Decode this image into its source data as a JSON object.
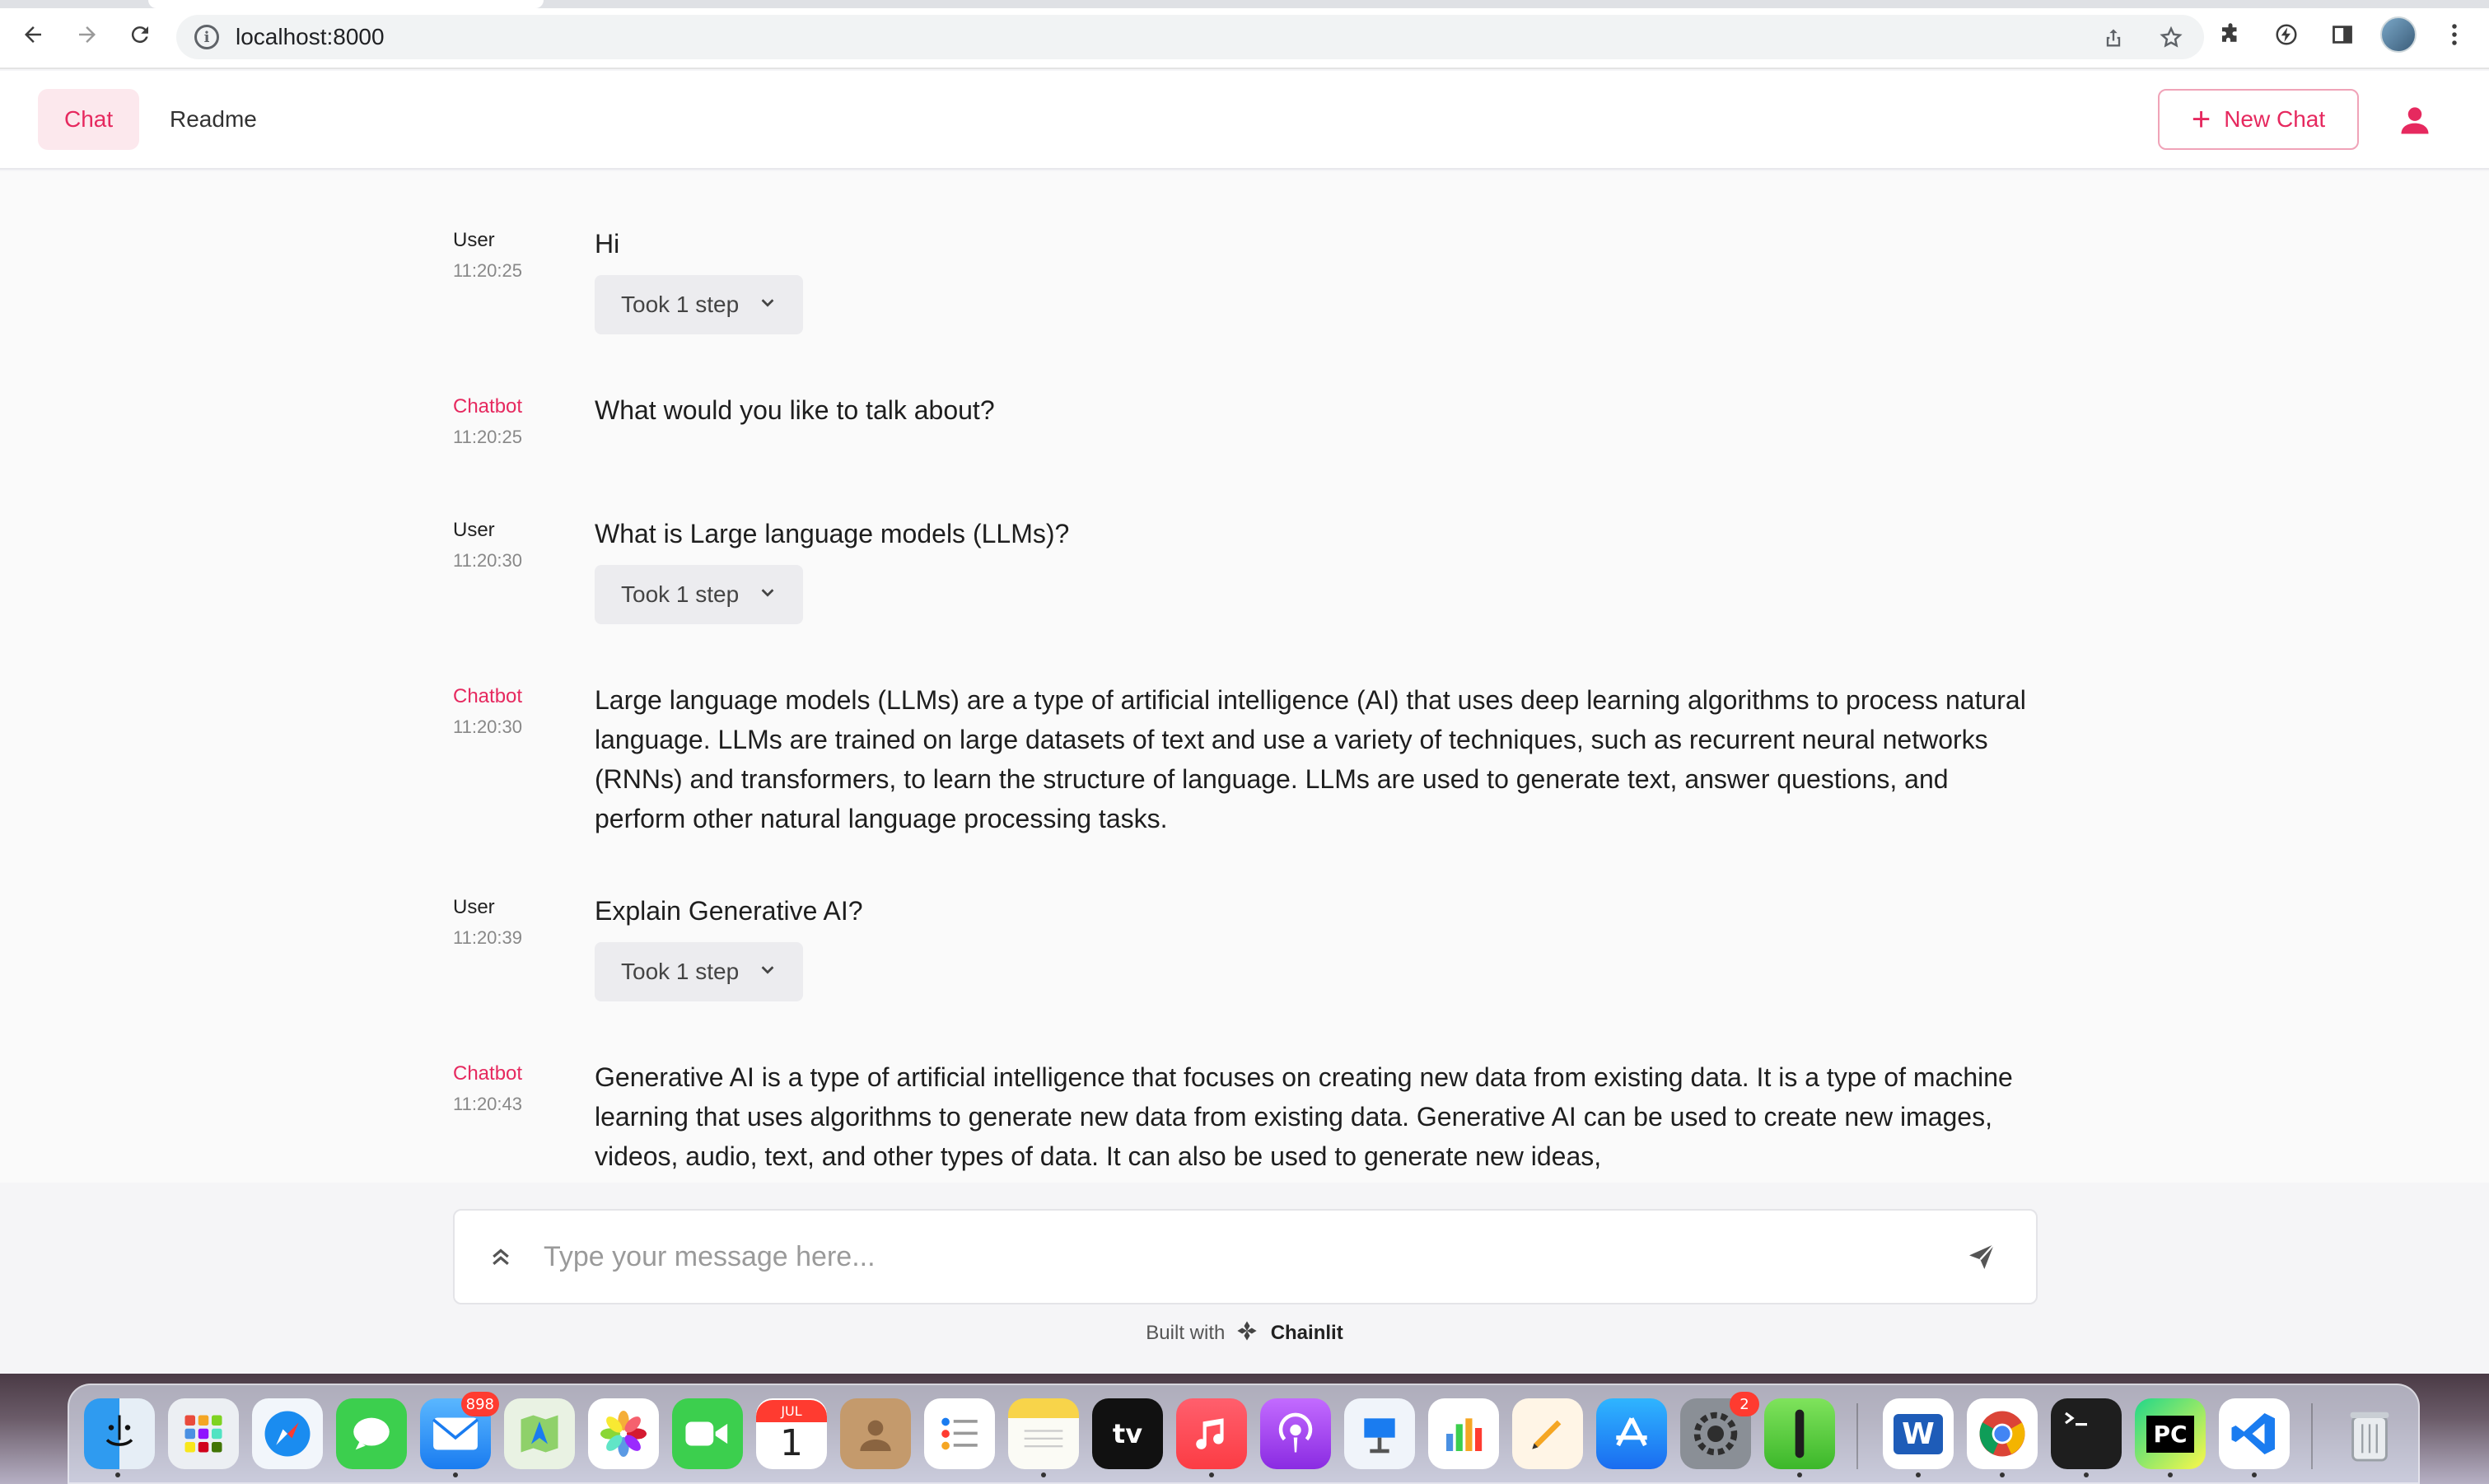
{
  "browser": {
    "url": "localhost:8000"
  },
  "header": {
    "tabs": [
      {
        "label": "Chat",
        "active": true
      },
      {
        "label": "Readme",
        "active": false
      }
    ],
    "new_chat_label": "New Chat"
  },
  "messages": [
    {
      "author": "User",
      "time": "11:20:25",
      "text": "Hi",
      "step": "Took 1 step"
    },
    {
      "author": "Chatbot",
      "time": "11:20:25",
      "text": "What would you like to talk about?"
    },
    {
      "author": "User",
      "time": "11:20:30",
      "text": "What is Large language models (LLMs)?",
      "step": "Took 1 step"
    },
    {
      "author": "Chatbot",
      "time": "11:20:30",
      "text": "Large language models (LLMs) are a type of artificial intelligence (AI) that uses deep learning algorithms to process natural language. LLMs are trained on large datasets of text and use a variety of techniques, such as recurrent neural networks (RNNs) and transformers, to learn the structure of language. LLMs are used to generate text, answer questions, and perform other natural language processing tasks."
    },
    {
      "author": "User",
      "time": "11:20:39",
      "text": "Explain Generative AI?",
      "step": "Took 1 step"
    },
    {
      "author": "Chatbot",
      "time": "11:20:43",
      "text": "Generative AI is a type of artificial intelligence that focuses on creating new data from existing data. It is a type of machine learning that uses algorithms to generate new data from existing data. Generative AI can be used to create new images, videos, audio, text, and other types of data. It can also be used to generate new ideas,"
    }
  ],
  "composer": {
    "placeholder": "Type your message here..."
  },
  "footer": {
    "built_with": "Built with",
    "brand": "Chainlit"
  },
  "dock": {
    "mail_badge": "898",
    "settings_badge": "2",
    "calendar_month": "JUL",
    "calendar_day": "1",
    "tv_label": "tv",
    "word_label": "W",
    "pycharm_label": "PC"
  },
  "colors": {
    "accent": "#e6295f",
    "accent_light": "#fce8ed"
  }
}
